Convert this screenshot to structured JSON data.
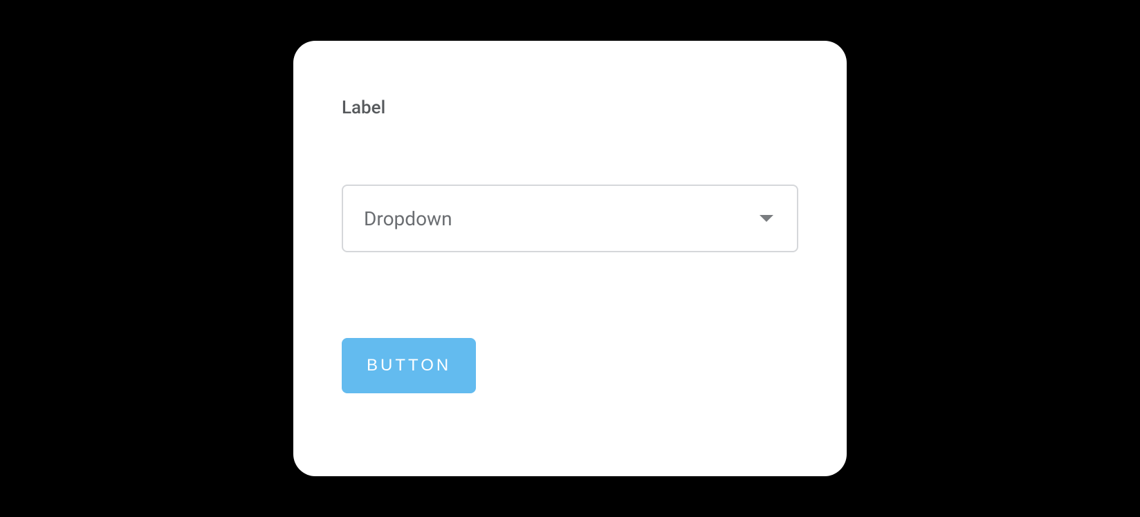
{
  "form": {
    "label": "Label",
    "dropdown": {
      "selected": "Dropdown"
    },
    "button_label": "BUTTON"
  }
}
